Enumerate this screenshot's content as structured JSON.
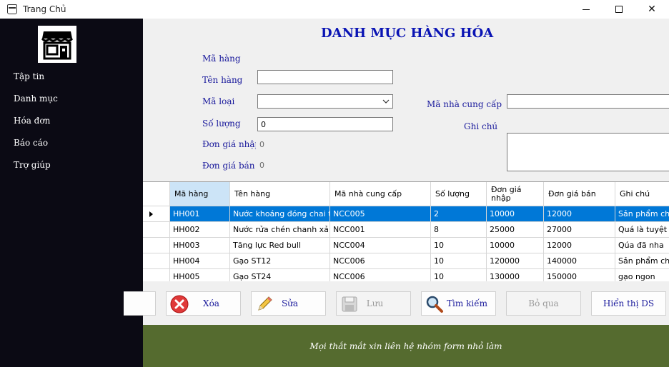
{
  "window": {
    "title": "Trang Chủ"
  },
  "sidebar": {
    "items": [
      {
        "label": "Tập tin"
      },
      {
        "label": "Danh mục"
      },
      {
        "label": "Hóa đơn"
      },
      {
        "label": "Báo cáo"
      },
      {
        "label": "Trợ giúp"
      }
    ]
  },
  "form": {
    "heading": "DANH MỤC HÀNG HÓA",
    "ma_hang_label": "Mã hàng",
    "ma_hang_value": "",
    "ten_hang_label": "Tên hàng",
    "ten_hang_value": "",
    "ma_loai_label": "Mã loại",
    "ma_loai_value": "",
    "so_luong_label": "Số lượng",
    "so_luong_value": "0",
    "don_gia_nhap_label": "Đơn giá nhập",
    "don_gia_nhap_value": "0",
    "don_gia_ban_label": "Đơn giá bán",
    "don_gia_ban_value": "0",
    "ma_ncc_label": "Mã nhà cung cấp",
    "ma_ncc_value": "",
    "ghi_chu_label": "Ghi chú",
    "ghi_chu_value": ""
  },
  "grid": {
    "columns": [
      "Mã hàng",
      "Tên hàng",
      "Mã nhà cung cấp",
      "Số lượng",
      "Đơn giá nhập",
      "Đơn giá bán",
      "Ghi chú"
    ],
    "rows": [
      [
        "HH001",
        "Nước khoáng đóng chai t...",
        "NCC005",
        "2",
        "10000",
        "12000",
        "Sản phẩm chấ"
      ],
      [
        "HH002",
        "Nước rửa chén chanh xả",
        "NCC001",
        "8",
        "25000",
        "27000",
        "Quá là tuyệt v"
      ],
      [
        "HH003",
        "Tăng lực Red bull",
        "NCC004",
        "10",
        "10000",
        "12000",
        "Qúa đã nha"
      ],
      [
        "HH004",
        "Gạo ST12",
        "NCC006",
        "10",
        "120000",
        "140000",
        "Sản phẩm chấ"
      ],
      [
        "HH005",
        "Gạo ST24",
        "NCC006",
        "10",
        "130000",
        "150000",
        "gạo ngon"
      ]
    ]
  },
  "toolbar": {
    "delete_label": "Xóa",
    "edit_label": "Sửa",
    "save_label": "Lưu",
    "search_label": "Tìm kiếm",
    "skip_label": "Bỏ qua",
    "show_label": "Hiển thị DS"
  },
  "footer": {
    "text": "Mọi thắt mắt xin liên hệ nhóm form nhỏ làm"
  },
  "colors": {
    "sidebar": "#0b0a14",
    "footer": "#556b2f",
    "selection": "#0078d7",
    "label": "#1a1a9c",
    "heading": "#0a14b4"
  }
}
